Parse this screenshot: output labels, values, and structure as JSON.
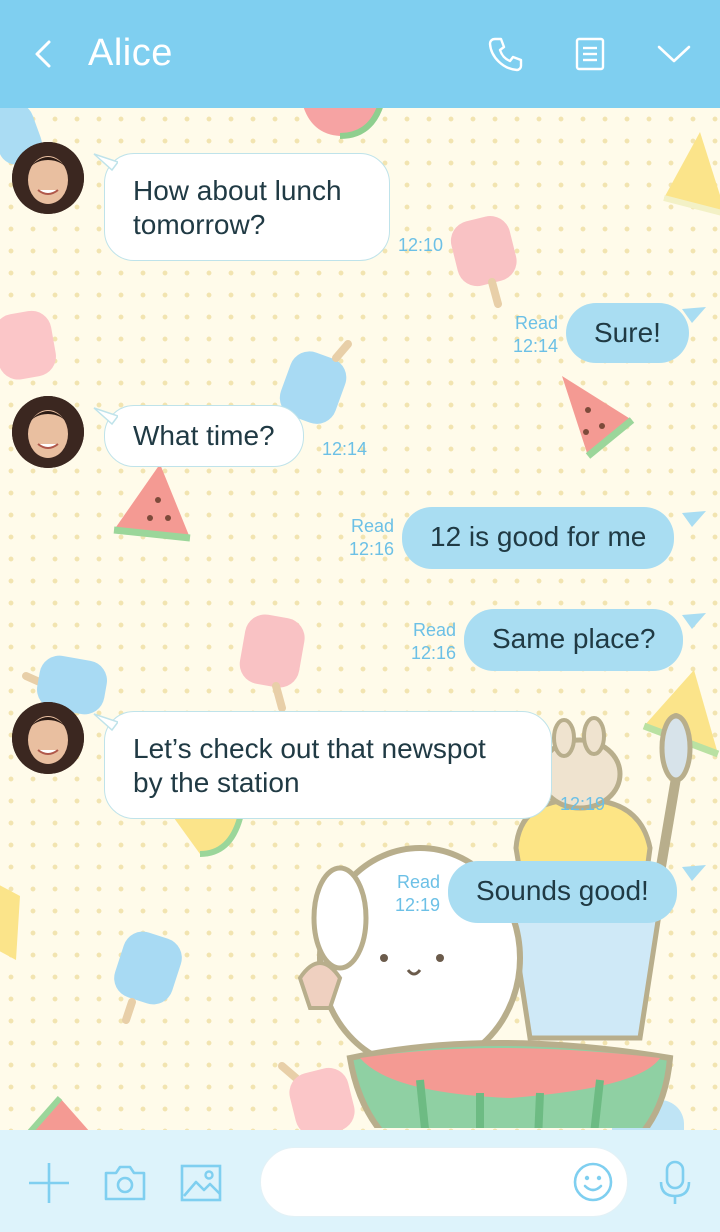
{
  "header": {
    "title": "Alice",
    "background": "#7fcff0"
  },
  "messages": [
    {
      "side": "in",
      "line1": "How about lunch",
      "line2": "tomorrow?",
      "time": "12:10"
    },
    {
      "side": "out",
      "text": "Sure!",
      "read": "Read",
      "time": "12:14"
    },
    {
      "side": "in",
      "text": "What time?",
      "time": "12:14"
    },
    {
      "side": "out",
      "text": "12 is good for me",
      "read": "Read",
      "time": "12:16"
    },
    {
      "side": "out",
      "text": "Same place?",
      "read": "Read",
      "time": "12:16"
    },
    {
      "side": "in",
      "line1": "Let’s check out that newspot",
      "line2": "by the station",
      "time": "12:19"
    },
    {
      "side": "out",
      "text": "Sounds good!",
      "read": "Read",
      "time": "12:19"
    }
  ],
  "footer": {
    "input_value": "",
    "input_placeholder": ""
  },
  "colors": {
    "accent": "#7fcff0",
    "outgoing_bubble": "#a9ddf2",
    "incoming_bubble": "#ffffff",
    "meta_text": "#6cc0e6",
    "footer_bg": "#ddf3fb"
  },
  "icons": {
    "back": "chevron-left-icon",
    "call": "phone-icon",
    "notes": "notes-icon",
    "menu": "chevron-down-icon",
    "add": "plus-icon",
    "camera": "camera-icon",
    "image": "image-icon",
    "emoji": "smiley-icon",
    "mic": "microphone-icon"
  }
}
